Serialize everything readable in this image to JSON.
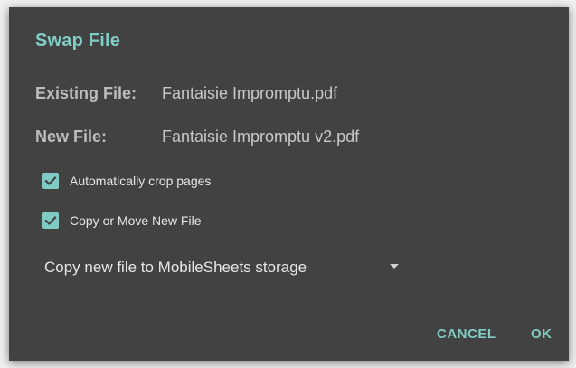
{
  "dialog": {
    "title": "Swap File",
    "existing_file_label": "Existing File:",
    "existing_file_value": "Fantaisie Impromptu.pdf",
    "new_file_label": "New File:",
    "new_file_value": "Fantaisie Impromptu v2.pdf",
    "options": [
      {
        "label": "Automatically crop pages",
        "checked": true
      },
      {
        "label": "Copy or Move New File",
        "checked": true
      }
    ],
    "storage_select": {
      "selected": "Copy new file to MobileSheets storage"
    },
    "buttons": {
      "cancel": "CANCEL",
      "ok": "OK"
    }
  },
  "colors": {
    "dialog_background": "#424242",
    "accent": "#80cbc4",
    "label_text": "#bdbdbd",
    "body_text": "#e6e6e6"
  },
  "icons": {
    "checkbox_checked": "check-icon",
    "dropdown": "dropdown-arrow-icon"
  }
}
